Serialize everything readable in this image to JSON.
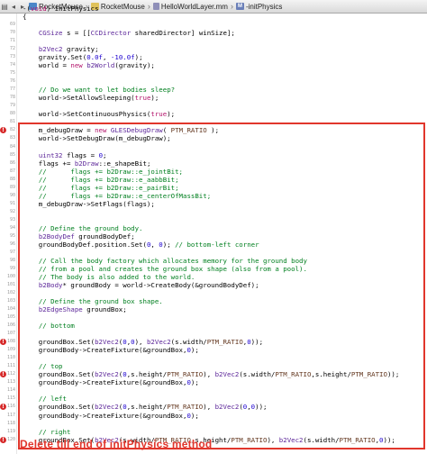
{
  "breadcrumb": [
    {
      "label": "RocketMouse",
      "icon": "project-icon"
    },
    {
      "label": "RocketMouse",
      "icon": "folder-icon"
    },
    {
      "label": "HelloWorldLayer.mm",
      "icon": "file-icon"
    },
    {
      "label": "-initPhysics",
      "icon": "method-icon",
      "badge": "M"
    }
  ],
  "annotation": "Delete till end of initPhysics method",
  "colors": {
    "annotation": "#e1362c",
    "error": "#d62a2a",
    "comment": "#007f1f",
    "keyword": "#b3146b",
    "type": "#5c2699",
    "number": "#1c00cf"
  },
  "lines": [
    {
      "ln": "",
      "error": false,
      "code": "-(void) initPhysics"
    },
    {
      "ln": "",
      "error": false,
      "code": "{"
    },
    {
      "ln": "69",
      "error": false,
      "code": ""
    },
    {
      "ln": "70",
      "error": false,
      "code": "    CGSize s = [[CCDirector sharedDirector] winSize];"
    },
    {
      "ln": "71",
      "error": false,
      "code": ""
    },
    {
      "ln": "72",
      "error": false,
      "code": "    b2Vec2 gravity;"
    },
    {
      "ln": "73",
      "error": false,
      "code": "    gravity.Set(0.0f, -10.0f);"
    },
    {
      "ln": "74",
      "error": false,
      "code": "    world = new b2World(gravity);"
    },
    {
      "ln": "75",
      "error": false,
      "code": ""
    },
    {
      "ln": "76",
      "error": false,
      "code": ""
    },
    {
      "ln": "77",
      "error": false,
      "code": "    // Do we want to let bodies sleep?"
    },
    {
      "ln": "78",
      "error": false,
      "code": "    world->SetAllowSleeping(true);"
    },
    {
      "ln": "79",
      "error": false,
      "code": ""
    },
    {
      "ln": "80",
      "error": false,
      "code": "    world->SetContinuousPhysics(true);"
    },
    {
      "ln": "81",
      "error": false,
      "code": ""
    },
    {
      "ln": "82",
      "error": true,
      "code": "    m_debugDraw = new GLESDebugDraw( PTM_RATIO );"
    },
    {
      "ln": "83",
      "error": false,
      "code": "    world->SetDebugDraw(m_debugDraw);"
    },
    {
      "ln": "84",
      "error": false,
      "code": ""
    },
    {
      "ln": "85",
      "error": false,
      "code": "    uint32 flags = 0;"
    },
    {
      "ln": "86",
      "error": false,
      "code": "    flags += b2Draw::e_shapeBit;"
    },
    {
      "ln": "87",
      "error": false,
      "code": "    //      flags += b2Draw::e_jointBit;"
    },
    {
      "ln": "88",
      "error": false,
      "code": "    //      flags += b2Draw::e_aabbBit;"
    },
    {
      "ln": "89",
      "error": false,
      "code": "    //      flags += b2Draw::e_pairBit;"
    },
    {
      "ln": "90",
      "error": false,
      "code": "    //      flags += b2Draw::e_centerOfMassBit;"
    },
    {
      "ln": "91",
      "error": false,
      "code": "    m_debugDraw->SetFlags(flags);"
    },
    {
      "ln": "92",
      "error": false,
      "code": ""
    },
    {
      "ln": "93",
      "error": false,
      "code": ""
    },
    {
      "ln": "94",
      "error": false,
      "code": "    // Define the ground body."
    },
    {
      "ln": "95",
      "error": false,
      "code": "    b2BodyDef groundBodyDef;"
    },
    {
      "ln": "96",
      "error": false,
      "code": "    groundBodyDef.position.Set(0, 0); // bottom-left corner"
    },
    {
      "ln": "97",
      "error": false,
      "code": ""
    },
    {
      "ln": "98",
      "error": false,
      "code": "    // Call the body factory which allocates memory for the ground body"
    },
    {
      "ln": "99",
      "error": false,
      "code": "    // from a pool and creates the ground box shape (also from a pool)."
    },
    {
      "ln": "100",
      "error": false,
      "code": "    // The body is also added to the world."
    },
    {
      "ln": "101",
      "error": false,
      "code": "    b2Body* groundBody = world->CreateBody(&groundBodyDef);"
    },
    {
      "ln": "102",
      "error": false,
      "code": ""
    },
    {
      "ln": "103",
      "error": false,
      "code": "    // Define the ground box shape."
    },
    {
      "ln": "104",
      "error": false,
      "code": "    b2EdgeShape groundBox;"
    },
    {
      "ln": "105",
      "error": false,
      "code": ""
    },
    {
      "ln": "106",
      "error": false,
      "code": "    // bottom"
    },
    {
      "ln": "107",
      "error": false,
      "code": ""
    },
    {
      "ln": "108",
      "error": true,
      "code": "    groundBox.Set(b2Vec2(0,0), b2Vec2(s.width/PTM_RATIO,0));"
    },
    {
      "ln": "109",
      "error": false,
      "code": "    groundBody->CreateFixture(&groundBox,0);"
    },
    {
      "ln": "110",
      "error": false,
      "code": ""
    },
    {
      "ln": "111",
      "error": false,
      "code": "    // top"
    },
    {
      "ln": "112",
      "error": true,
      "code": "    groundBox.Set(b2Vec2(0,s.height/PTM_RATIO), b2Vec2(s.width/PTM_RATIO,s.height/PTM_RATIO));"
    },
    {
      "ln": "113",
      "error": false,
      "code": "    groundBody->CreateFixture(&groundBox,0);"
    },
    {
      "ln": "114",
      "error": false,
      "code": ""
    },
    {
      "ln": "115",
      "error": false,
      "code": "    // left"
    },
    {
      "ln": "116",
      "error": true,
      "code": "    groundBox.Set(b2Vec2(0,s.height/PTM_RATIO), b2Vec2(0,0));"
    },
    {
      "ln": "117",
      "error": false,
      "code": "    groundBody->CreateFixture(&groundBox,0);"
    },
    {
      "ln": "118",
      "error": false,
      "code": ""
    },
    {
      "ln": "119",
      "error": false,
      "code": "    // right"
    },
    {
      "ln": "120",
      "error": true,
      "code": "    groundBox.Set(b2Vec2(s.width/PTM_RATIO,s.height/PTM_RATIO), b2Vec2(s.width/PTM_RATIO,0));"
    }
  ]
}
